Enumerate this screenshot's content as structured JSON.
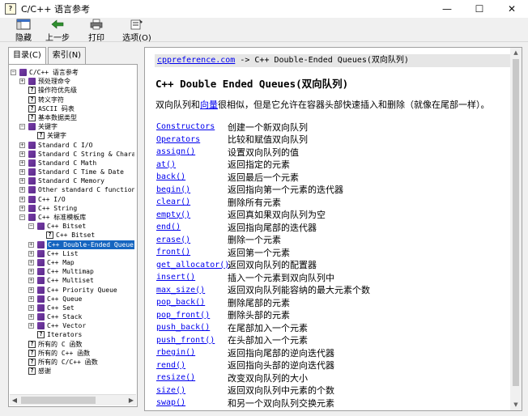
{
  "window": {
    "title": "C/C++ 语言参考",
    "minimize": "—",
    "maximize": "☐",
    "close": "✕"
  },
  "toolbar": [
    {
      "label": "隐藏",
      "icon": "hide-icon"
    },
    {
      "label": "上一步",
      "icon": "back-arrow-icon"
    },
    {
      "label": "打印",
      "icon": "print-icon"
    },
    {
      "label": "选项(O)",
      "icon": "options-icon"
    }
  ],
  "left_tabs": [
    {
      "label": "目录(C)",
      "active": true
    },
    {
      "label": "索引(N)",
      "active": false
    }
  ],
  "tree": [
    {
      "label": "C/C++ 语言参考",
      "level": 0,
      "expander": "−",
      "icon": "book"
    },
    {
      "label": "预处理命令",
      "level": 1,
      "expander": "+",
      "icon": "book"
    },
    {
      "label": "操作符优先级",
      "level": 1,
      "expander": "",
      "icon": "page"
    },
    {
      "label": "转义字符",
      "level": 1,
      "expander": "",
      "icon": "page"
    },
    {
      "label": "ASCII 码表",
      "level": 1,
      "expander": "",
      "icon": "page"
    },
    {
      "label": "基本数据类型",
      "level": 1,
      "expander": "",
      "icon": "page"
    },
    {
      "label": "关键字",
      "level": 1,
      "expander": "−",
      "icon": "book"
    },
    {
      "label": "关键字",
      "level": 2,
      "expander": "",
      "icon": "page"
    },
    {
      "label": "Standard C I/O",
      "level": 1,
      "expander": "+",
      "icon": "book"
    },
    {
      "label": "Standard C String & Character",
      "level": 1,
      "expander": "+",
      "icon": "book"
    },
    {
      "label": "Standard C Math",
      "level": 1,
      "expander": "+",
      "icon": "book"
    },
    {
      "label": "Standard C Time & Date",
      "level": 1,
      "expander": "+",
      "icon": "book"
    },
    {
      "label": "Standard C Memory",
      "level": 1,
      "expander": "+",
      "icon": "book"
    },
    {
      "label": "Other standard C functions",
      "level": 1,
      "expander": "+",
      "icon": "book"
    },
    {
      "label": "C++ I/O",
      "level": 1,
      "expander": "+",
      "icon": "book"
    },
    {
      "label": "C++ String",
      "level": 1,
      "expander": "+",
      "icon": "book"
    },
    {
      "label": "C++ 标准模板库",
      "level": 1,
      "expander": "−",
      "icon": "book"
    },
    {
      "label": "C++ Bitset",
      "level": 2,
      "expander": "−",
      "icon": "book"
    },
    {
      "label": "C++ Bitset",
      "level": 3,
      "expander": "",
      "icon": "page"
    },
    {
      "label": "C++ Double-Ended Queue",
      "level": 2,
      "expander": "+",
      "icon": "book",
      "selected": true
    },
    {
      "label": "C++ List",
      "level": 2,
      "expander": "+",
      "icon": "book"
    },
    {
      "label": "C++ Map",
      "level": 2,
      "expander": "+",
      "icon": "book"
    },
    {
      "label": "C++ Multimap",
      "level": 2,
      "expander": "+",
      "icon": "book"
    },
    {
      "label": "C++ Multiset",
      "level": 2,
      "expander": "+",
      "icon": "book"
    },
    {
      "label": "C++ Priority Queue",
      "level": 2,
      "expander": "+",
      "icon": "book"
    },
    {
      "label": "C++ Queue",
      "level": 2,
      "expander": "+",
      "icon": "book"
    },
    {
      "label": "C++ Set",
      "level": 2,
      "expander": "+",
      "icon": "book"
    },
    {
      "label": "C++ Stack",
      "level": 2,
      "expander": "+",
      "icon": "book"
    },
    {
      "label": "C++ Vector",
      "level": 2,
      "expander": "+",
      "icon": "book"
    },
    {
      "label": "Iterators",
      "level": 2,
      "expander": "",
      "icon": "page"
    },
    {
      "label": "所有的 C 函数",
      "level": 1,
      "expander": "",
      "icon": "page"
    },
    {
      "label": "所有的 C++ 函数",
      "level": 1,
      "expander": "",
      "icon": "page"
    },
    {
      "label": "所有的 C/C++ 函数",
      "level": 1,
      "expander": "",
      "icon": "page"
    },
    {
      "label": "感谢",
      "level": 1,
      "expander": "",
      "icon": "page"
    }
  ],
  "content": {
    "nav_link": "cppreference.com",
    "nav_rest": " -> C++ Double-Ended Queues(双向队列)",
    "title": "C++ Double Ended Queues(双向队列)",
    "intro_before": "双向队列和",
    "intro_link": "向量",
    "intro_after": "很相似，但是它允许在容器头部快速插入和删除（就像在尾部一样）。",
    "functions": [
      {
        "name": "Constructors",
        "desc": "创建一个新双向队列"
      },
      {
        "name": "Operators",
        "desc": "比较和赋值双向队列"
      },
      {
        "name": "assign()",
        "desc": "设置双向队列的值"
      },
      {
        "name": "at()",
        "desc": "返回指定的元素"
      },
      {
        "name": "back()",
        "desc": "返回最后一个元素"
      },
      {
        "name": "begin()",
        "desc": "返回指向第一个元素的迭代器"
      },
      {
        "name": "clear()",
        "desc": "删除所有元素"
      },
      {
        "name": "empty()",
        "desc": "返回真如果双向队列为空"
      },
      {
        "name": "end()",
        "desc": "返回指向尾部的迭代器"
      },
      {
        "name": "erase()",
        "desc": "删除一个元素"
      },
      {
        "name": "front()",
        "desc": "返回第一个元素"
      },
      {
        "name": "get_allocator()",
        "desc": "返回双向队列的配置器"
      },
      {
        "name": "insert()",
        "desc": "插入一个元素到双向队列中"
      },
      {
        "name": "max_size()",
        "desc": "返回双向队列能容纳的最大元素个数"
      },
      {
        "name": "pop_back()",
        "desc": "删除尾部的元素"
      },
      {
        "name": "pop_front()",
        "desc": "删除头部的元素"
      },
      {
        "name": "push_back()",
        "desc": "在尾部加入一个元素"
      },
      {
        "name": "push_front()",
        "desc": "在头部加入一个元素"
      },
      {
        "name": "rbegin()",
        "desc": "返回指向尾部的逆向迭代器"
      },
      {
        "name": "rend()",
        "desc": "返回指向头部的逆向迭代器"
      },
      {
        "name": "resize()",
        "desc": "改变双向队列的大小"
      },
      {
        "name": "size()",
        "desc": "返回双向队列中元素的个数"
      },
      {
        "name": "swap()",
        "desc": "和另一个双向队列交换元素"
      }
    ]
  },
  "colors": {
    "link": "#0000ee",
    "selection": "#1565c0",
    "book_icon": "#6a35a0"
  }
}
